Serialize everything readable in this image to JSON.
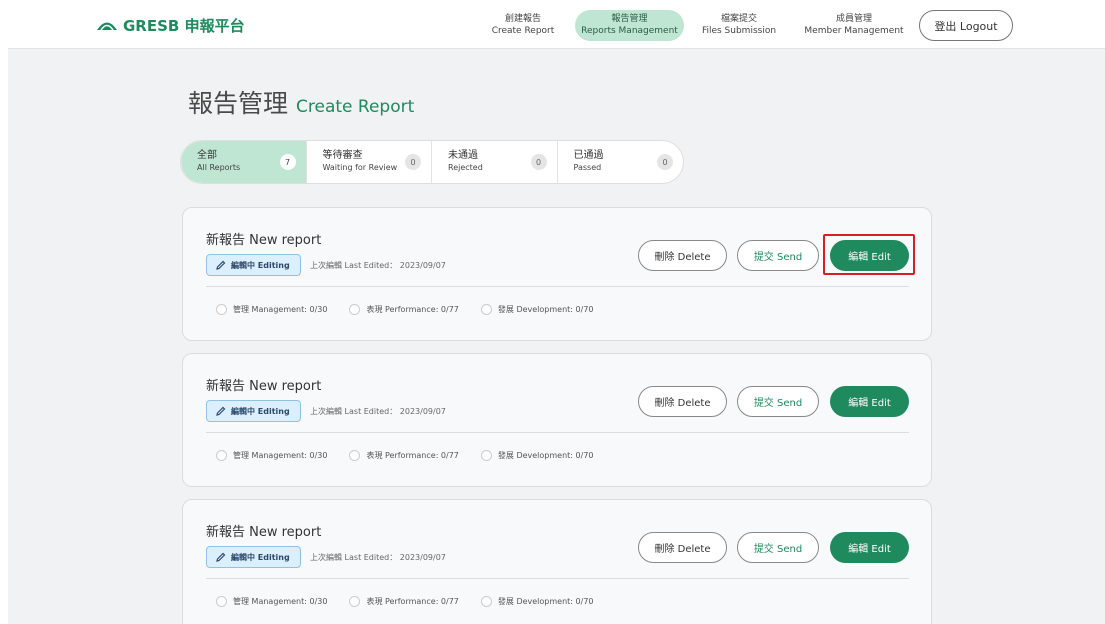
{
  "header": {
    "logo_text": "GRESB 申報平台",
    "nav": [
      {
        "zh": "創建報告",
        "en": "Create Report",
        "active": false
      },
      {
        "zh": "報告管理",
        "en": "Reports Management",
        "active": true
      },
      {
        "zh": "檔案提交",
        "en": "Files Submission",
        "active": false
      },
      {
        "zh": "成員管理",
        "en": "Member Management",
        "active": false
      }
    ],
    "logout_label": "登出 Logout"
  },
  "page": {
    "title_zh": "報告管理",
    "title_en": "Create Report"
  },
  "tabs": [
    {
      "zh": "全部",
      "en": "All Reports",
      "count": "7",
      "active": true
    },
    {
      "zh": "等待審查",
      "en": "Waiting for Review",
      "count": "0",
      "active": false
    },
    {
      "zh": "未通過",
      "en": "Rejected",
      "count": "0",
      "active": false
    },
    {
      "zh": "已通過",
      "en": "Passed",
      "count": "0",
      "active": false
    }
  ],
  "reports": [
    {
      "title": "新報告 New report",
      "status": "編輯中 Editing",
      "last_edited": "上次編輯 Last Edited： 2023/09/07",
      "progress": [
        "管理 Management: 0/30",
        "表現 Performance: 0/77",
        "發展 Development: 0/70"
      ],
      "delete_label": "刪除 Delete",
      "send_label": "提交 Send",
      "edit_label": "編輯 Edit"
    },
    {
      "title": "新報告 New report",
      "status": "編輯中 Editing",
      "last_edited": "上次編輯 Last Edited： 2023/09/07",
      "progress": [
        "管理 Management: 0/30",
        "表現 Performance: 0/77",
        "發展 Development: 0/70"
      ],
      "delete_label": "刪除 Delete",
      "send_label": "提交 Send",
      "edit_label": "編輯 Edit"
    },
    {
      "title": "新報告 New report",
      "status": "編輯中 Editing",
      "last_edited": "上次編輯 Last Edited： 2023/09/07",
      "progress": [
        "管理 Management: 0/30",
        "表現 Performance: 0/77",
        "發展 Development: 0/70"
      ],
      "delete_label": "刪除 Delete",
      "send_label": "提交 Send",
      "edit_label": "編輯 Edit"
    }
  ],
  "colors": {
    "brand_green": "#1e8a5e",
    "active_tab_bg": "#bfe6d3",
    "editing_badge_bg": "#dcefff",
    "highlight_red": "#d42020"
  },
  "icons": {
    "logo": "leaf-dome-icon",
    "editing": "pencil-icon",
    "progress": "circle-icon"
  }
}
